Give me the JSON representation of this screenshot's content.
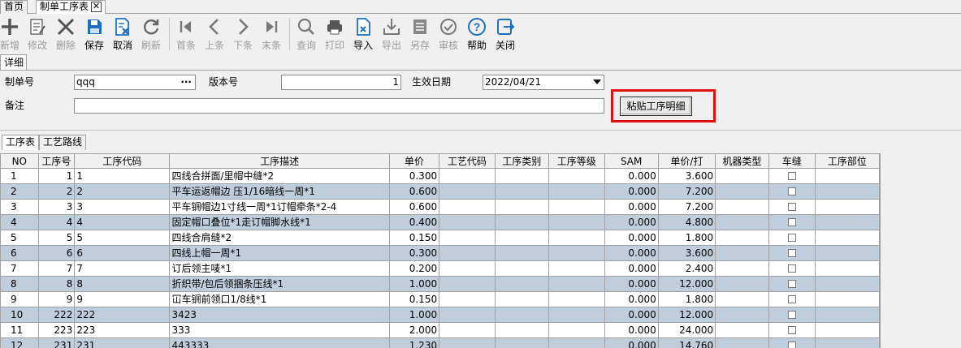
{
  "tabs": [
    {
      "label": "首页",
      "active": false
    },
    {
      "label": "制单工序表",
      "active": true,
      "close": "✕"
    }
  ],
  "toolbar": [
    {
      "name": "new",
      "label": "新增",
      "icon": "plus-icon",
      "disabled": true
    },
    {
      "name": "edit",
      "label": "修改",
      "icon": "edit-icon",
      "disabled": true
    },
    {
      "name": "delete",
      "label": "删除",
      "icon": "delete-icon",
      "disabled": true
    },
    {
      "name": "save",
      "label": "保存",
      "icon": "save-icon",
      "disabled": false
    },
    {
      "name": "cancel",
      "label": "取消",
      "icon": "cancel-icon",
      "disabled": false
    },
    {
      "name": "refresh",
      "label": "刷新",
      "icon": "refresh-icon",
      "disabled": true
    },
    {
      "name": "first",
      "label": "首条",
      "icon": "first-icon",
      "disabled": true
    },
    {
      "name": "prev",
      "label": "上条",
      "icon": "prev-icon",
      "disabled": true
    },
    {
      "name": "next",
      "label": "下条",
      "icon": "next-icon",
      "disabled": true
    },
    {
      "name": "last",
      "label": "末条",
      "icon": "last-icon",
      "disabled": true
    },
    {
      "name": "query",
      "label": "查询",
      "icon": "search-icon",
      "disabled": true
    },
    {
      "name": "print",
      "label": "打印",
      "icon": "print-icon",
      "disabled": true
    },
    {
      "name": "import",
      "label": "导入",
      "icon": "import-icon",
      "disabled": false
    },
    {
      "name": "export",
      "label": "导出",
      "icon": "export-icon",
      "disabled": true
    },
    {
      "name": "saveas",
      "label": "另存",
      "icon": "saveas-icon",
      "disabled": true
    },
    {
      "name": "audit",
      "label": "审核",
      "icon": "audit-icon",
      "disabled": true
    },
    {
      "name": "help",
      "label": "帮助",
      "icon": "help-icon",
      "disabled": false
    },
    {
      "name": "close",
      "label": "关闭",
      "icon": "exit-icon",
      "disabled": false
    }
  ],
  "detail": {
    "tab_label": "详细",
    "order_no_label": "制单号",
    "order_no_value": "qqq",
    "order_no_button": "···",
    "version_label": "版本号",
    "version_value": "1",
    "effective_date_label": "生效日期",
    "effective_date_value": "2022/04/21",
    "remark_label": "备注",
    "remark_value": "",
    "paste_button": "粘贴工序明细"
  },
  "grid_tabs": [
    {
      "label": "工序表",
      "active": true
    },
    {
      "label": "工艺路线",
      "active": false
    }
  ],
  "columns": [
    "NO",
    "工序号",
    "工序代码",
    "工序描述",
    "单价",
    "工艺代码",
    "工序类别",
    "工序等级",
    "SAM",
    "单价/打",
    "机器类型",
    "车缝",
    "工序部位"
  ],
  "rows": [
    {
      "no": "1",
      "seq": "1",
      "code": "1",
      "desc": "四线合拼面/里帽中缝*2",
      "price": "0.300",
      "craft": "",
      "cat": "",
      "grade": "",
      "sam": "0.000",
      "dozen": "3.600",
      "machine": "",
      "sew": false,
      "part": ""
    },
    {
      "no": "2",
      "seq": "2",
      "code": "2",
      "desc": "平车运返帽边 压1/16暗线一周*1",
      "price": "0.600",
      "craft": "",
      "cat": "",
      "grade": "",
      "sam": "0.000",
      "dozen": "7.200",
      "machine": "",
      "sew": false,
      "part": ""
    },
    {
      "no": "3",
      "seq": "3",
      "code": "3",
      "desc": "平车锎帽边1寸线一周*1订帽牵条*2-4",
      "price": "0.600",
      "craft": "",
      "cat": "",
      "grade": "",
      "sam": "0.000",
      "dozen": "7.200",
      "machine": "",
      "sew": false,
      "part": ""
    },
    {
      "no": "4",
      "seq": "4",
      "code": "4",
      "desc": "固定帽口叠位*1走订帽脚水线*1",
      "price": "0.400",
      "craft": "",
      "cat": "",
      "grade": "",
      "sam": "0.000",
      "dozen": "4.800",
      "machine": "",
      "sew": false,
      "part": ""
    },
    {
      "no": "5",
      "seq": "5",
      "code": "5",
      "desc": "四线合肩缝*2",
      "price": "0.150",
      "craft": "",
      "cat": "",
      "grade": "",
      "sam": "0.000",
      "dozen": "1.800",
      "machine": "",
      "sew": false,
      "part": ""
    },
    {
      "no": "6",
      "seq": "6",
      "code": "6",
      "desc": "四线上帽一周*1",
      "price": "0.300",
      "craft": "",
      "cat": "",
      "grade": "",
      "sam": "0.000",
      "dozen": "3.600",
      "machine": "",
      "sew": false,
      "part": ""
    },
    {
      "no": "7",
      "seq": "7",
      "code": "7",
      "desc": "订后领主唛*1",
      "price": "0.200",
      "craft": "",
      "cat": "",
      "grade": "",
      "sam": "0.000",
      "dozen": "2.400",
      "machine": "",
      "sew": false,
      "part": ""
    },
    {
      "no": "8",
      "seq": "8",
      "code": "8",
      "desc": "折织带/包后领捆条压线*1",
      "price": "1.000",
      "craft": "",
      "cat": "",
      "grade": "",
      "sam": "0.000",
      "dozen": "12.000",
      "machine": "",
      "sew": false,
      "part": ""
    },
    {
      "no": "9",
      "seq": "9",
      "code": "9",
      "desc": "冚车锎前领口1/8线*1",
      "price": "0.150",
      "craft": "",
      "cat": "",
      "grade": "",
      "sam": "0.000",
      "dozen": "1.800",
      "machine": "",
      "sew": false,
      "part": ""
    },
    {
      "no": "10",
      "seq": "222",
      "code": "222",
      "desc": "3423",
      "price": "1.000",
      "craft": "",
      "cat": "",
      "grade": "",
      "sam": "0.000",
      "dozen": "12.000",
      "machine": "",
      "sew": false,
      "part": ""
    },
    {
      "no": "11",
      "seq": "223",
      "code": "223",
      "desc": "333",
      "price": "2.000",
      "craft": "",
      "cat": "",
      "grade": "",
      "sam": "0.000",
      "dozen": "24.000",
      "machine": "",
      "sew": false,
      "part": ""
    },
    {
      "no": "12",
      "seq": "231",
      "code": "231",
      "desc": "443333",
      "price": "1.230",
      "craft": "",
      "cat": "",
      "grade": "",
      "sam": "0.000",
      "dozen": "14.760",
      "machine": "",
      "sew": false,
      "part": ""
    }
  ],
  "colors": {
    "accent": "#1f6fbf",
    "disabled_icon": "#9a9a9a",
    "row_alt": "#c0cddb",
    "highlight": "#e01010"
  }
}
